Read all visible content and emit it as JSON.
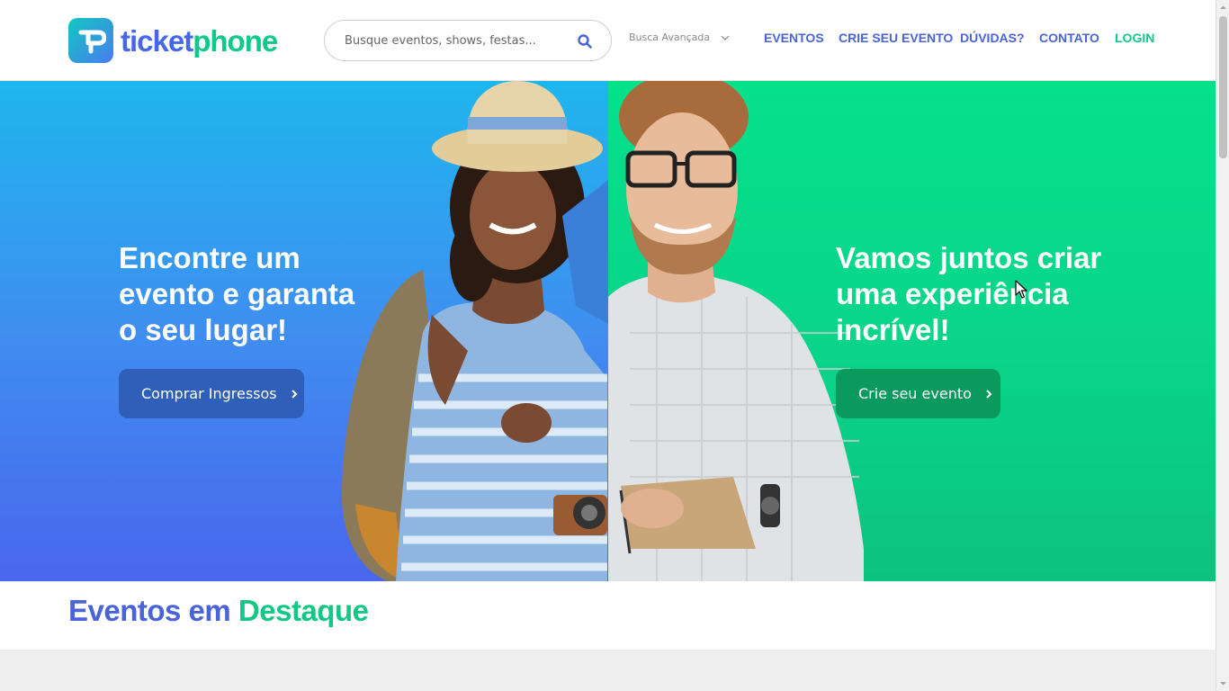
{
  "header": {
    "logo": {
      "part1": "ticket",
      "part2": "phone"
    },
    "search": {
      "placeholder": "Busque eventos, shows, festas...",
      "icon": "search-icon"
    },
    "advanced_search": "Busca Avançada",
    "nav": [
      {
        "label": "EVENTOS"
      },
      {
        "label": "CRIE SEU EVENTO"
      },
      {
        "label": "DÚVIDAS?"
      },
      {
        "label": "CONTATO"
      },
      {
        "label": "LOGIN"
      }
    ]
  },
  "hero": {
    "left": {
      "title_lines": [
        "Encontre um",
        "evento e garanta",
        "o seu lugar!"
      ],
      "button": "Comprar Ingressos"
    },
    "right": {
      "title_lines": [
        "Vamos juntos criar",
        "uma experiência",
        "incrível!"
      ],
      "button": "Crie seu evento"
    }
  },
  "featured": {
    "word1": "Eventos em",
    "word2": "Destaque"
  },
  "colors": {
    "brand_blue": "#4a63d8",
    "brand_green": "#13c785",
    "hero_blue_top": "#1eb6ee",
    "hero_blue_bottom": "#4a66ee",
    "hero_green": "#05e08b",
    "btn_blue": "#2f5fb8",
    "btn_green": "#0a9a5e"
  }
}
